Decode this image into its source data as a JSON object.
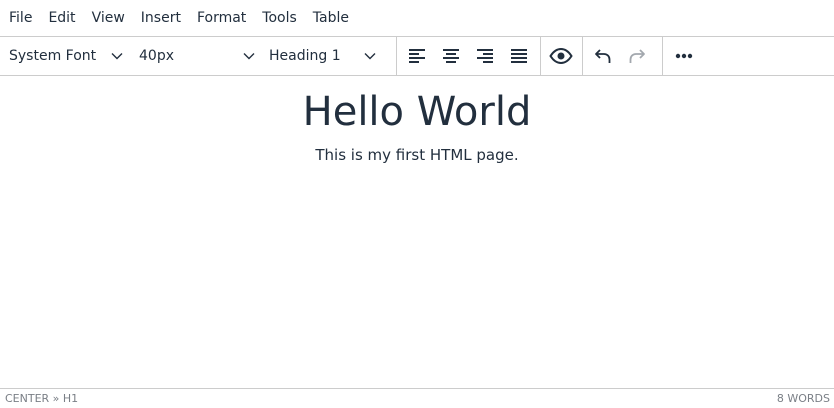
{
  "menubar": {
    "items": [
      "File",
      "Edit",
      "View",
      "Insert",
      "Format",
      "Tools",
      "Table"
    ]
  },
  "toolbar": {
    "font_family": "System Font",
    "font_size": "40px",
    "block_format": "Heading 1",
    "icons": [
      "align-left-icon",
      "align-center-icon",
      "align-right-icon",
      "align-justify-icon",
      "preview-icon",
      "undo-icon",
      "redo-icon",
      "more-icon"
    ]
  },
  "content": {
    "heading": "Hello World",
    "paragraph": "This is my first HTML page."
  },
  "statusbar": {
    "path": "CENTER » H1",
    "word_count": "8 WORDS"
  },
  "colors": {
    "text": "#222f3e",
    "border": "#cccccc",
    "disabled_icon": "#a3a8ae",
    "status_text": "#7a7f86"
  }
}
